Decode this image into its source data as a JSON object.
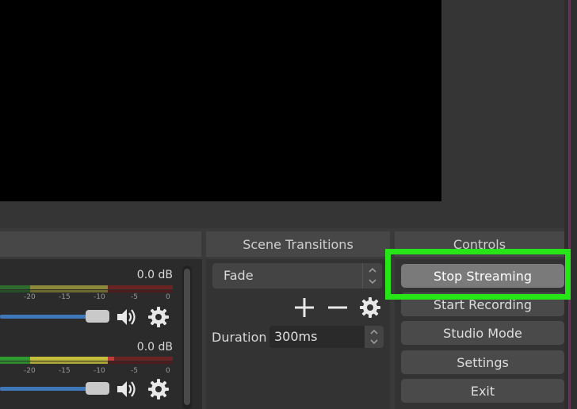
{
  "docks": {
    "scene_transitions": "Scene Transitions",
    "controls": "Controls"
  },
  "mixer": {
    "tracks": [
      {
        "db": "0.0 dB",
        "ticks": [
          "-20",
          "-15",
          "-10",
          "-5",
          "0"
        ],
        "volume": 0.55
      },
      {
        "db": "0.0 dB",
        "ticks": [
          "-20",
          "-15",
          "-10",
          "-5",
          "0"
        ],
        "volume": 0.55
      }
    ]
  },
  "transitions": {
    "selected": "Fade",
    "duration_label": "Duration",
    "duration_value": "300ms"
  },
  "controls": {
    "stop_streaming": "Stop Streaming",
    "start_recording": "Start Recording",
    "studio_mode": "Studio Mode",
    "settings": "Settings",
    "exit": "Exit"
  },
  "colors": {
    "highlight": "#26e617",
    "fader": "#3f78b8",
    "meter_green": "#2f8f2f",
    "meter_yellow": "#b7b23a",
    "meter_red": "#8a2a2a"
  },
  "icons": [
    "speaker-icon",
    "gear-icon",
    "plus-icon",
    "minus-icon",
    "chevron-up-icon",
    "chevron-down-icon"
  ]
}
